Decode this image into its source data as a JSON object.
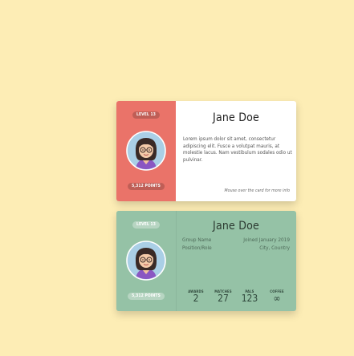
{
  "profile": {
    "name": "Jane Doe",
    "level": "LEVEL 13",
    "points": "5,312 POINTS"
  },
  "card_front": {
    "description": "Lorem ipsum dolor sit amet, consectetur adipiscing elit. Fusce a volutpat mauris, at molestie lacus. Nam vestibulum sodales odio ut pulvinar.",
    "hint": "Mouse over the card for more info"
  },
  "card_back": {
    "group": "Group Name",
    "joined": "Joined January 2019",
    "role": "Position/Role",
    "location": "City, Country",
    "stats": [
      {
        "label": "AWARDS",
        "value": "2"
      },
      {
        "label": "MATCHES",
        "value": "27"
      },
      {
        "label": "PALS",
        "value": "123"
      },
      {
        "label": "COFFEE",
        "value": "∞"
      }
    ]
  },
  "colors": {
    "background": "#fdedb5",
    "front_accent": "#ea7369",
    "back_accent": "#95c2a6"
  },
  "icons": {
    "avatar": "woman-with-glasses-avatar-icon"
  }
}
